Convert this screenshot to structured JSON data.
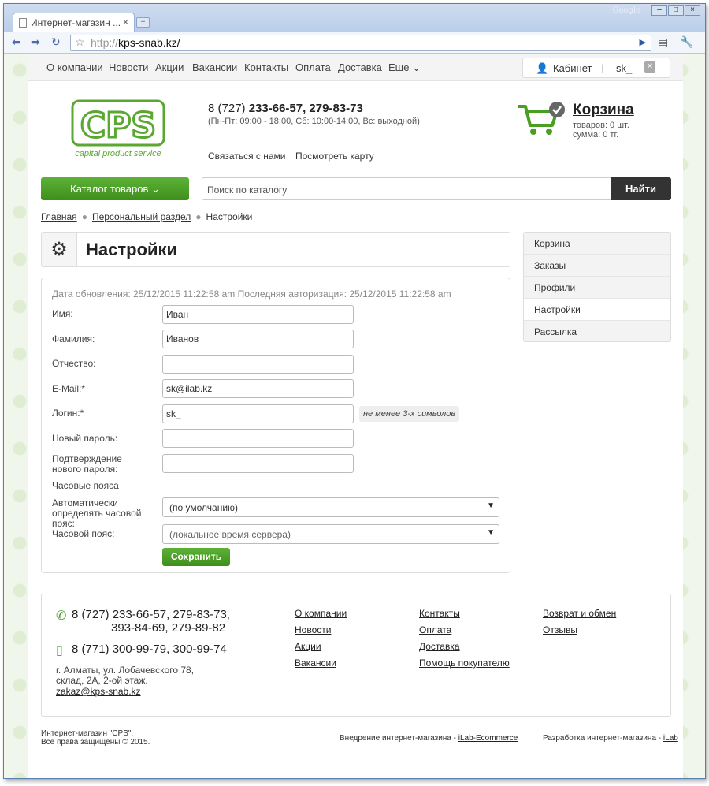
{
  "browser": {
    "tab_title": "Интернет-магазин ...",
    "tab_close": "×",
    "new_tab": "+",
    "brand": "Google",
    "url_scheme": "http://",
    "url_host": "kps-snab.kz/",
    "win_min": "–",
    "win_max": "□",
    "win_close": "×"
  },
  "topnav": {
    "items": [
      "О компании",
      "Новости",
      "Акции",
      "Вакансии",
      "Контакты",
      "Оплата",
      "Доставка",
      "Еще ⌄"
    ],
    "cabinet": "Кабинет",
    "user": "sk_"
  },
  "header": {
    "logo_text": "CPS",
    "logo_tagline": "capital product service",
    "phone_prefix": "8 (727) ",
    "phone_numbers": "233-66-57, 279-83-73",
    "hours": "(Пн-Пт: 09:00 - 18:00,  Сб: 10:00-14:00, Вс: выходной)",
    "link_contact": "Связаться с нами",
    "link_map": "Посмотреть карту",
    "cart_title": "Корзина",
    "cart_items": "товаров: 0 шт.",
    "cart_sum": "сумма: 0 тг."
  },
  "search": {
    "catalog_btn": "Каталог товаров ⌄",
    "placeholder": "Поиск по каталогу",
    "find_btn": "Найти"
  },
  "breadcrumb": {
    "items": [
      "Главная",
      "Персональный раздел",
      "Настройки"
    ]
  },
  "page": {
    "title": "Настройки"
  },
  "form": {
    "dates": "Дата обновления: 25/12/2015 11:22:58 am     Последняя авторизация: 25/12/2015 11:22:58 am",
    "labels": {
      "name": "Имя:",
      "surname": "Фамилия:",
      "patronymic": "Отчество:",
      "email": "E-Mail:*",
      "login": "Логин:*",
      "new_password": "Новый пароль:",
      "confirm_password": "Подтверждение нового пароля:",
      "timezones": "Часовые пояса",
      "auto_tz": "Автоматически определять часовой пояс:",
      "tz": "Часовой пояс:"
    },
    "values": {
      "name": "Иван",
      "surname": "Иванов",
      "patronymic": "",
      "email": "sk@ilab.kz",
      "login": "sk_",
      "new_password": "",
      "confirm_password": ""
    },
    "login_hint": "не менее 3-х символов",
    "auto_tz_value": "(по умолчанию)",
    "tz_value": "(локальное время сервера)",
    "save": "Сохранить"
  },
  "sidebar": {
    "items": [
      "Корзина",
      "Заказы",
      "Профили",
      "Настройки",
      "Рассылка"
    ],
    "active": "Настройки"
  },
  "footer": {
    "phone1": "8 (727) 233-66-57, 279-83-73,",
    "phone1b": "393-84-69, 279-89-82",
    "phone2": "8 (771) 300-99-79, 300-99-74",
    "address1": "г. Алматы, ул. Лобачевского 78,",
    "address2": "склад, 2А, 2-ой этаж.",
    "email": "zakaz@kps-snab.kz",
    "col1": [
      "О компании",
      "Новости",
      "Акции",
      "Вакансии"
    ],
    "col2": [
      "Контакты",
      "Оплата",
      "Доставка",
      "Помощь покупателю"
    ],
    "col3": [
      "Возврат и обмен",
      "Отзывы"
    ],
    "copy1": "Интернет-магазин \"CPS\".",
    "copy2": "Все права защищены © 2015.",
    "impl_text": "Внедрение интернет-магазина - ",
    "impl_link": "iLab-Ecommerce",
    "dev_text": "Разработка интернет-магазина - ",
    "dev_link": "iLab"
  }
}
